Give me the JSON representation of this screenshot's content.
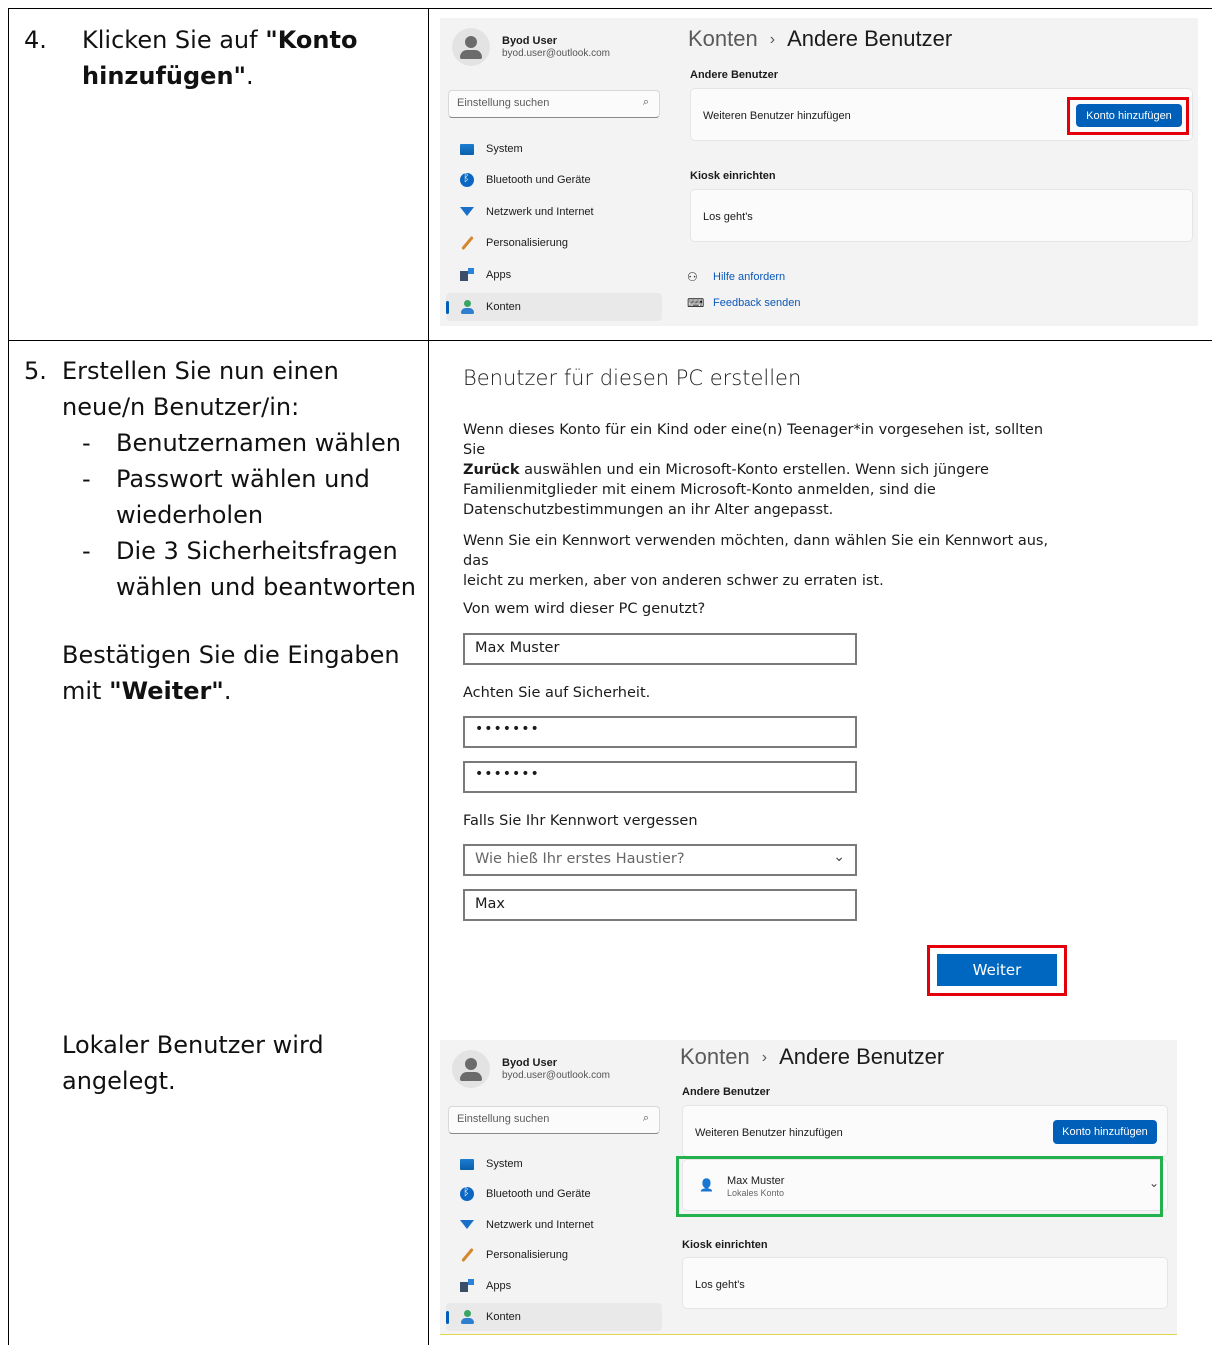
{
  "steps": {
    "step4": {
      "number": "4.",
      "text_before": "Klicken Sie auf ",
      "bold1": "\"Konto",
      "bold2": "hinzufügen\"",
      "text_after": "."
    },
    "step5": {
      "number": "5.",
      "line1": "Erstellen Sie nun einen",
      "line2": "neue/n Benutzer/in:",
      "bullets": [
        {
          "dash": "-",
          "text": "Benutzernamen wählen"
        },
        {
          "dash": "-",
          "text": "Passwort wählen und"
        },
        {
          "dash": "",
          "text": "wiederholen"
        },
        {
          "dash": "-",
          "text": "Die 3 Sicherheitsfragen"
        },
        {
          "dash": "",
          "text": "wählen und beantworten"
        }
      ],
      "confirm_line1": "Bestätigen Sie die Eingaben",
      "confirm_prefix": "mit ",
      "confirm_bold": "\"Weiter\"",
      "confirm_suffix": ".",
      "local_line1": "Lokaler Benutzer wird",
      "local_line2": "angelegt."
    }
  },
  "settings": {
    "user_name": "Byod User",
    "user_email": "byod.user@outlook.com",
    "search_placeholder": "Einstellung suchen",
    "nav": [
      {
        "label": "System",
        "icon": "system-icon"
      },
      {
        "label": "Bluetooth und Geräte",
        "icon": "bluetooth-icon"
      },
      {
        "label": "Netzwerk und Internet",
        "icon": "network-icon"
      },
      {
        "label": "Personalisierung",
        "icon": "brush-icon"
      },
      {
        "label": "Apps",
        "icon": "apps-icon"
      },
      {
        "label": "Konten",
        "icon": "accounts-icon"
      }
    ],
    "breadcrumb_parent": "Konten",
    "breadcrumb_sep": "›",
    "breadcrumb_current": "Andere Benutzer",
    "section_other_users": "Andere Benutzer",
    "add_user_label": "Weiteren Benutzer hinzufügen",
    "add_account_button": "Konto hinzufügen",
    "section_kiosk": "Kiosk einrichten",
    "kiosk_label": "Los geht's",
    "help_link": "Hilfe anfordern",
    "feedback_link": "Feedback senden",
    "new_user_name": "Max Muster",
    "new_user_type": "Lokales Konto"
  },
  "create_form": {
    "title": "Benutzer für diesen PC erstellen",
    "para1_a": "Wenn dieses Konto für ein Kind oder eine(n) Teenager*in vorgesehen ist, sollten Sie",
    "para1_bold": "Zurück",
    "para1_b": " auswählen und ein Microsoft-Konto erstellen. Wenn sich jüngere",
    "para1_c": "Familienmitglieder mit einem Microsoft-Konto anmelden, sind die",
    "para1_d": "Datenschutzbestimmungen an ihr Alter angepasst.",
    "para2_a": "Wenn Sie ein Kennwort verwenden möchten, dann wählen Sie ein Kennwort aus, das",
    "para2_b": "leicht zu merken, aber von anderen schwer zu erraten ist.",
    "who_label": "Von wem wird dieser PC genutzt?",
    "username_value": "Max Muster",
    "security_label": "Achten Sie auf Sicherheit.",
    "password_value": "•••••••",
    "password_repeat_value": "•••••••",
    "forgot_label": "Falls Sie Ihr Kennwort vergessen",
    "question_value": "Wie hieß Ihr erstes Haustier?",
    "answer_value": "Max",
    "next_button": "Weiter"
  },
  "colors": {
    "accent": "#005fb8",
    "highlight_red": "#e3000b",
    "highlight_green": "#22b14c"
  }
}
